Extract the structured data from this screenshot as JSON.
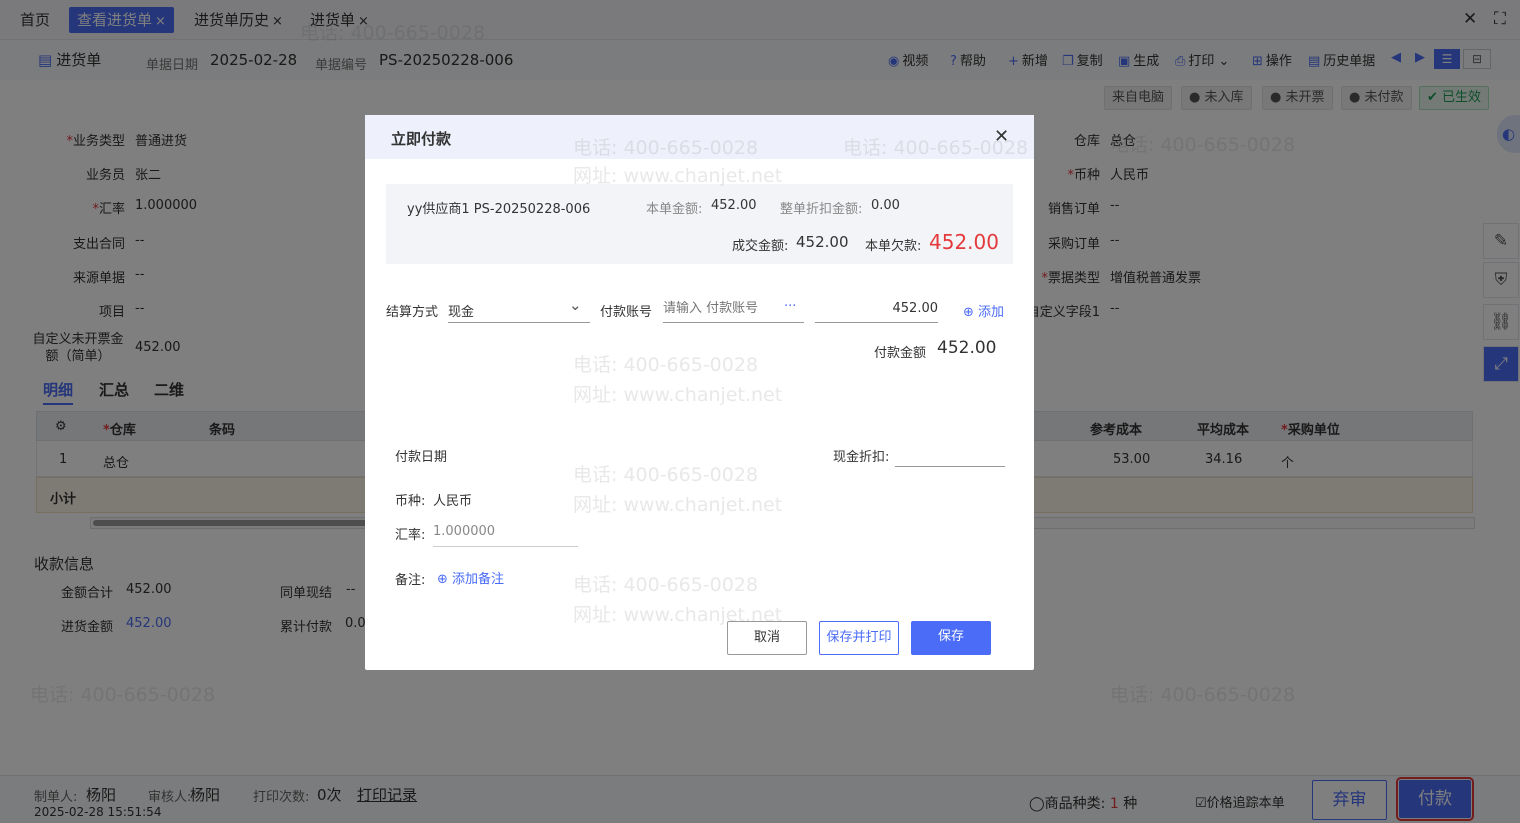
{
  "tabs": [
    {
      "label": "首页",
      "closable": false
    },
    {
      "label": "查看进货单",
      "closable": true,
      "active": true
    },
    {
      "label": "进货单历史",
      "closable": true
    },
    {
      "label": "进货单",
      "closable": true
    }
  ],
  "close_symbol": "×",
  "window": {
    "close": "✕",
    "maximize": "⛶"
  },
  "header": {
    "doc_title": "进货单",
    "date_label": "单据日期",
    "date_value": "2025-02-28",
    "number_label": "单据编号",
    "number_value": "PS-20250228-006"
  },
  "toolbar": {
    "video": "视频",
    "help": "帮助",
    "new": "新增",
    "copy": "复制",
    "generate": "生成",
    "print": "打印",
    "operate": "操作",
    "history": "历史单据"
  },
  "statuses": [
    "来自电脑",
    "未入库",
    "未开票",
    "未付款",
    "已生效"
  ],
  "form": {
    "business_type_label": "业务类型",
    "business_type": "普通进货",
    "salesman_label": "业务员",
    "salesman": "张二",
    "rate_label": "汇率",
    "rate": "1.000000",
    "contract_label": "支出合同",
    "contract": "--",
    "source_label": "来源单据",
    "source": "--",
    "project_label": "项目",
    "project": "--",
    "custom_label_1": "自定义未开票金",
    "custom_label_2": "额（简单）",
    "custom_value": "452.00",
    "warehouse_label": "仓库",
    "warehouse": "总仓",
    "currency_label": "币种",
    "currency": "人民币",
    "sales_order_label": "销售订单",
    "sales_order": "--",
    "purchase_order_label": "采购订单",
    "purchase_order": "--",
    "invoice_type_label": "票据类型",
    "invoice_type": "增值税普通发票",
    "custom_field_label": "自定义字段1",
    "custom_field": "--"
  },
  "subtabs": [
    "明细",
    "汇总",
    "二维"
  ],
  "grid": {
    "headers": [
      "仓库",
      "条码",
      "参考成本",
      "平均成本",
      "采购单位"
    ],
    "row": {
      "index": "1",
      "warehouse": "总仓",
      "ref_cost": "53.00",
      "avg_cost": "34.16",
      "unit": "个"
    },
    "subtotal_label": "小计"
  },
  "payment_info": {
    "title": "收款信息",
    "total_label": "金额合计",
    "total": "452.00",
    "same_label": "同单现结",
    "same": "--",
    "purchase_label": "进货金额",
    "purchase": "452.00",
    "cumulative_label": "累计付款",
    "cumulative": "0.0"
  },
  "footer": {
    "maker_label": "制单人:",
    "maker": "杨阳",
    "reviewer_label": "审核人:",
    "reviewer": "杨阳",
    "print_count_label": "打印次数:",
    "print_count": "0次",
    "print_record": "打印记录",
    "timestamp": "2025-02-28 15:51:54",
    "product_types_label": "商品种类:",
    "product_types_count": "1",
    "product_types_unit": "种",
    "track_price": "价格追踪本单",
    "abandon": "弃审",
    "pay": "付款"
  },
  "modal": {
    "title": "立即付款",
    "supplier_doc": "yy供应商1 PS-20250228-006",
    "amount_label": "本单金额:",
    "amount": "452.00",
    "discount_label": "整单折扣金额:",
    "discount": "0.00",
    "deal_label": "成交金额:",
    "deal": "452.00",
    "owed_label": "本单欠款:",
    "owed": "452.00",
    "settle_label": "结算方式",
    "settle_value": "现金",
    "account_label": "付款账号",
    "account_placeholder": "请输入 付款账号",
    "ellipsis": "···",
    "line_amount": "452.00",
    "add": "添加",
    "pay_amount_label": "付款金额",
    "pay_amount": "452.00",
    "pay_date_label": "付款日期",
    "cash_discount_label": "现金折扣:",
    "currency_label": "币种:",
    "currency": "人民币",
    "rate_label": "汇率:",
    "rate_placeholder": "1.000000",
    "note_label": "备注:",
    "add_note": "添加备注",
    "cancel": "取消",
    "save_print": "保存并打印",
    "save": "保存"
  },
  "watermark": {
    "phone": "电话: 400-665-0028",
    "site": "网址: www.chanjet.net"
  },
  "colors": {
    "accent": "#4a6cf7",
    "danger": "#e4393c",
    "success": "#1c9c53"
  }
}
